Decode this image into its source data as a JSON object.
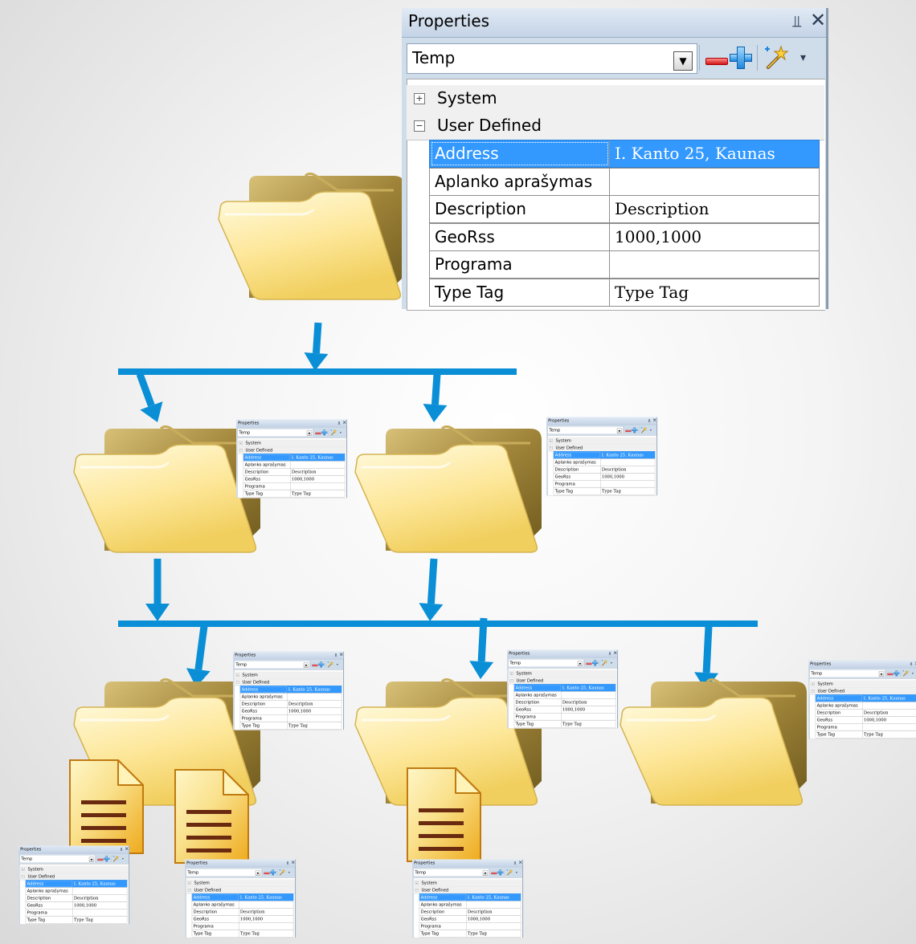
{
  "panel": {
    "title": "Properties",
    "pin_glyph": "⫫",
    "close_glyph": "✕",
    "selector_value": "Temp",
    "dropdown_glyph": "▼",
    "wand_dropdown_glyph": "▾",
    "categories": [
      {
        "label": "System",
        "expander": "+"
      },
      {
        "label": "User Defined",
        "expander": "−"
      }
    ],
    "rows": [
      {
        "name": "Address",
        "value": "I. Kanto 25, Kaunas",
        "selected": true
      },
      {
        "name": "Aplanko aprašymas",
        "value": ""
      },
      {
        "name": "Description",
        "value": "Description"
      },
      {
        "name": "GeoRss",
        "value": "1000,1000"
      },
      {
        "name": "Programa",
        "value": ""
      },
      {
        "name": "Type Tag",
        "value": "Type Tag"
      }
    ]
  },
  "icons": {
    "folder": "folder-icon",
    "document": "document-icon",
    "arrow": "arrow-down-icon",
    "pin": "pin-icon",
    "close": "close-icon",
    "minus": "minus-icon",
    "plus": "plus-icon",
    "wand": "wand-icon"
  },
  "colors": {
    "connector": "#0a8fd6",
    "selection": "#3399ff",
    "folder_back": "#b59a4c",
    "folder_front": "#fde79a",
    "document": "#f7d76a",
    "document_lines": "#6a2a10"
  }
}
